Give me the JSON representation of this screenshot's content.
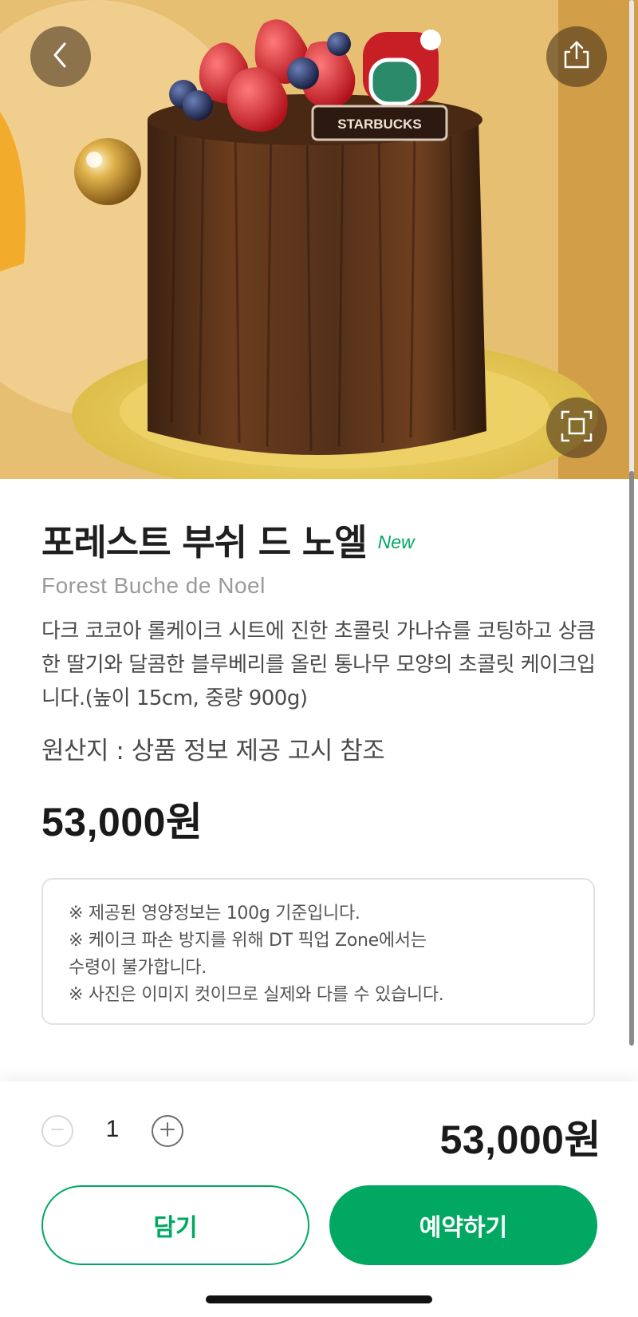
{
  "product": {
    "name": "포레스트 부쉬 드 노엘",
    "badge": "New",
    "name_en": "Forest Buche de Noel",
    "description": "다크 코코아 롤케이크 시트에 진한 초콜릿 가나슈를 코팅하고 상큼한 딸기와 달콤한 블루베리를 올린 통나무 모양의 초콜릿 케이크입니다.(높이 15cm, 중량 900g)",
    "origin": "원산지 : 상품 정보 제공 고시 참조",
    "price": "53,000원",
    "image_plaque_text": "STARBUCKS"
  },
  "notice": {
    "lines": [
      "※ 제공된 영양정보는 100g 기준입니다.",
      "※ 케이크 파손 방지를 위해 DT 픽업 Zone에서는",
      "수령이 불가합니다.",
      "※ 사진은 이미지 컷이므로 실제와 다를 수 있습니다."
    ]
  },
  "order": {
    "quantity": "1",
    "total_price": "53,000원",
    "cart_label": "담기",
    "reserve_label": "예약하기"
  },
  "icons": {
    "back": "chevron-left-icon",
    "share": "share-icon",
    "zoom": "fullscreen-icon",
    "minus": "minus-icon",
    "plus": "plus-icon"
  },
  "colors": {
    "brand_green": "#00a862",
    "text_dark": "#1f1f1f",
    "text_gray": "#9a9a9a"
  }
}
